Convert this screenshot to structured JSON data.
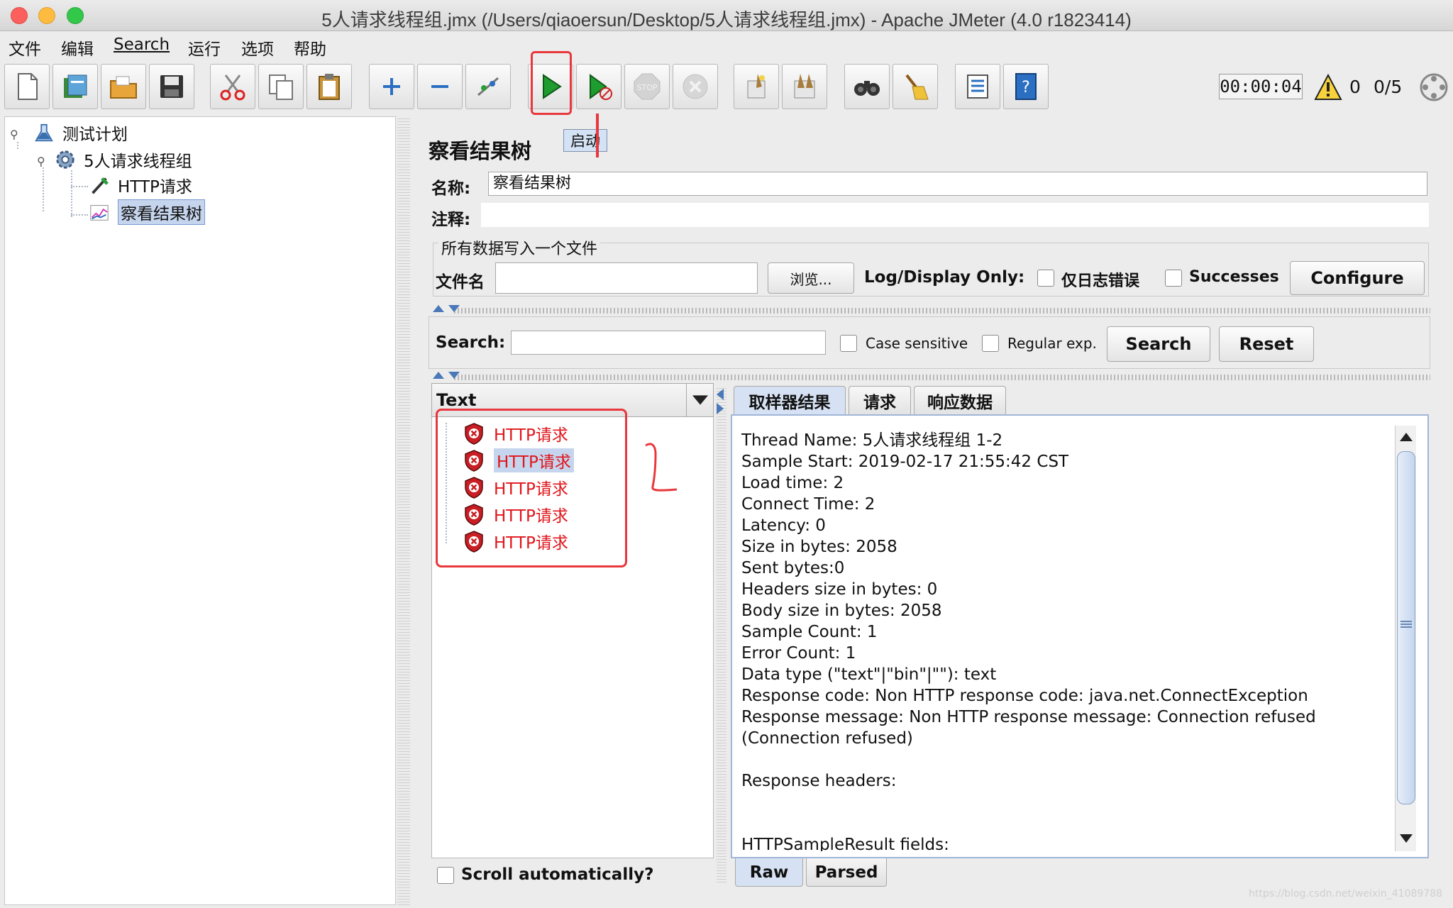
{
  "window": {
    "title": "5人请求线程组.jmx (/Users/qiaoersun/Desktop/5人请求线程组.jmx) - Apache JMeter (4.0 r1823414)"
  },
  "menubar": {
    "file": "文件",
    "edit": "编辑",
    "search": "Search",
    "run": "运行",
    "options": "选项",
    "help": "帮助"
  },
  "toolbar": {
    "timer": "00:00:04",
    "warning_count": "0",
    "threads": "0/5",
    "start_tooltip": "启动",
    "icons": [
      "new-icon",
      "templates-icon",
      "open-icon",
      "save-icon",
      "cut-icon",
      "copy-icon",
      "paste-icon",
      "expand-icon",
      "collapse-icon",
      "toggle-icon",
      "start-icon",
      "start-no-pause-icon",
      "stop-icon",
      "shutdown-icon",
      "clear-icon",
      "clear-all-icon",
      "search-icon",
      "reset-search-icon",
      "function-helper-icon",
      "help-icon"
    ]
  },
  "tree": {
    "nodes": [
      {
        "label": "测试计划",
        "icon": "test-plan-icon"
      },
      {
        "label": "5人请求线程组",
        "icon": "thread-group-icon"
      },
      {
        "label": "HTTP请求",
        "icon": "http-sampler-icon"
      },
      {
        "label": "察看结果树",
        "icon": "listener-icon"
      }
    ]
  },
  "listener": {
    "title": "察看结果树",
    "name_label": "名称:",
    "name_value": "察看结果树",
    "comment_label": "注释:",
    "comment_value": "",
    "file_group_label": "所有数据写入一个文件",
    "filename_label": "文件名",
    "filename_value": "",
    "browse_button": "浏览...",
    "log_display_label": "Log/Display Only:",
    "errors_only_label": "仅日志错误",
    "successes_label": "Successes",
    "configure_button": "Configure"
  },
  "search": {
    "label": "Search:",
    "value": "",
    "case_sensitive_label": "Case sensitive",
    "regex_label": "Regular exp.",
    "search_button": "Search",
    "reset_button": "Reset"
  },
  "results": {
    "renderer": "Text",
    "items": [
      "HTTP请求",
      "HTTP请求",
      "HTTP请求",
      "HTTP请求",
      "HTTP请求"
    ],
    "selected_index": 1,
    "scroll_auto_label": "Scroll automatically?"
  },
  "tabs": {
    "sampler_result": "取样器结果",
    "request": "请求",
    "response_data": "响应数据",
    "raw": "Raw",
    "parsed": "Parsed"
  },
  "response": {
    "lines": "Thread Name: 5人请求线程组 1-2\nSample Start: 2019-02-17 21:55:42 CST\nLoad time: 2\nConnect Time: 2\nLatency: 0\nSize in bytes: 2058\nSent bytes:0\nHeaders size in bytes: 0\nBody size in bytes: 2058\nSample Count: 1\nError Count: 1\nData type (\"text\"|\"bin\"|\"\"): text\nResponse code: Non HTTP response code: java.net.ConnectException\nResponse message: Non HTTP response message: Connection refused\n(Connection refused)\n\nResponse headers:\n\n\nHTTPSampleResult fields:"
  },
  "watermark": "https://blog.csdn.net/weixin_41089788",
  "colors": {
    "error_red": "#e0151b",
    "annotation_red": "#e8383d",
    "selection_blue": "#c6d5ee"
  }
}
